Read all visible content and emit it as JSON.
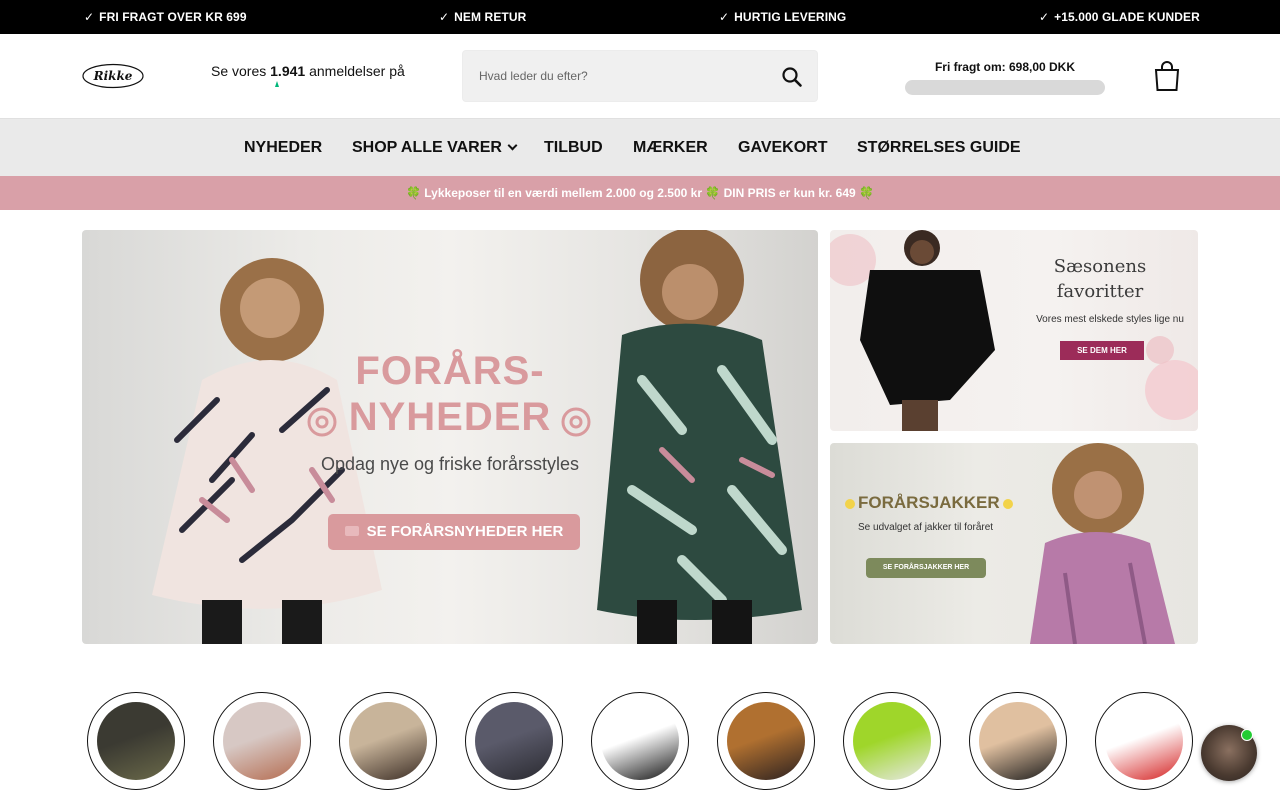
{
  "usp_bar": {
    "items": [
      "FRI FRAGT OVER KR 699",
      "NEM RETUR",
      "HURTIG LEVERING",
      "+15.000 GLADE KUNDER"
    ],
    "check_glyph": "✓"
  },
  "header": {
    "logo_text": "Rikke",
    "reviews": {
      "prefix": "Se vores",
      "count": "1.941",
      "suffix": "anmeldelser på"
    },
    "search": {
      "placeholder": "Hvad leder du efter?"
    },
    "free_shipping": {
      "label": "Fri fragt om: 698,00 DKK",
      "progress_fraction": 0.0
    },
    "cart_icon": "shopping-bag-icon"
  },
  "nav": {
    "items": [
      {
        "label": "NYHEDER"
      },
      {
        "label": "SHOP ALLE VARER",
        "has_dropdown": true
      },
      {
        "label": "TILBUD"
      },
      {
        "label": "MÆRKER"
      },
      {
        "label": "GAVEKORT"
      },
      {
        "label": "STØRRELSES GUIDE"
      }
    ]
  },
  "promo": {
    "clover": "🍀",
    "text_part1": "Lykkeposer til en værdi mellem 2.000 og 2.500 kr",
    "text_part2": "DIN PRIS er kun kr. 649"
  },
  "hero": {
    "title_line1": "FORÅRS-",
    "title_line2": "NYHEDER",
    "subtitle": "Opdag nye og friske forårsstyles",
    "cta": "SE FORÅRSNYHEDER HER"
  },
  "side_banners": [
    {
      "title_line1": "Sæsonens",
      "title_line2": "favoritter",
      "subtitle": "Vores mest elskede styles lige nu",
      "cta": "SE DEM HER"
    },
    {
      "title": "FORÅRSJAKKER",
      "subtitle": "Se udvalget af jakker til foråret",
      "cta": "SE FORÅRSJAKKER HER"
    }
  ],
  "colors": {
    "usp_bg": "#000000",
    "nav_bg": "#eaeaea",
    "promo_bg": "#d9a0a8",
    "hero_accent": "#d99a9d",
    "banner_button": "#9c2c59",
    "jacket_button": "#7d8a5c",
    "online_dot": "#22cc33"
  },
  "category_circles": [
    {
      "name": "jacket-category",
      "palette": [
        "#3b3a32",
        "#6b6a4a"
      ]
    },
    {
      "name": "dress-category",
      "palette": [
        "#d7c8c4",
        "#b46b4f"
      ]
    },
    {
      "name": "knit-category",
      "palette": [
        "#c8b49a",
        "#3a2c24"
      ]
    },
    {
      "name": "tunic-category",
      "palette": [
        "#5a5a6a",
        "#2a2a30"
      ]
    },
    {
      "name": "stripe-category",
      "palette": [
        "#ffffff",
        "#111111"
      ]
    },
    {
      "name": "leggings-category",
      "palette": [
        "#b07030",
        "#2a2020"
      ]
    },
    {
      "name": "tshirt-category",
      "palette": [
        "#9fd62a",
        "#e8e8e8"
      ]
    },
    {
      "name": "lingerie-category",
      "palette": [
        "#e0c0a0",
        "#1a1a1a"
      ]
    },
    {
      "name": "tights-category",
      "palette": [
        "#ffffff",
        "#d42020"
      ]
    }
  ],
  "chat": {
    "icon": "chat-avatar-icon",
    "status": "online"
  }
}
